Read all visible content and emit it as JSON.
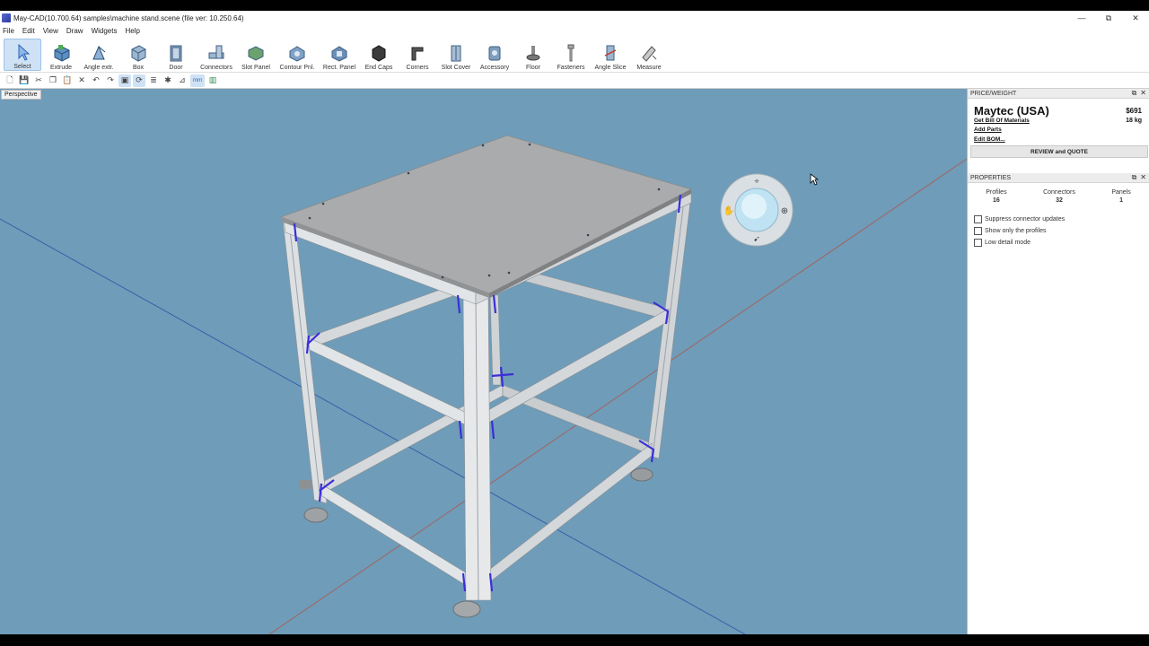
{
  "window": {
    "title": "May-CAD(10.700.64) samples\\machine stand.scene (file ver: 10.250.64)",
    "controls": {
      "minimize": "—",
      "restore": "⧉",
      "close": "✕"
    }
  },
  "menu": [
    "File",
    "Edit",
    "View",
    "Draw",
    "Widgets",
    "Help"
  ],
  "ribbon": {
    "tools": [
      {
        "label": "Select",
        "icon": "cursor-icon",
        "active": true
      },
      {
        "label": "Extrude",
        "icon": "extrude-icon"
      },
      {
        "label": "Angle extr.",
        "icon": "angle-extrude-icon"
      },
      {
        "label": "Box",
        "icon": "box-icon"
      },
      {
        "label": "Door",
        "icon": "door-icon"
      },
      {
        "label": "Connectors",
        "icon": "connectors-icon"
      },
      {
        "label": "Slot Panel",
        "icon": "slot-panel-icon"
      },
      {
        "label": "Contour Pnl.",
        "icon": "contour-panel-icon"
      },
      {
        "label": "Rect. Panel",
        "icon": "rect-panel-icon"
      },
      {
        "label": "End Caps",
        "icon": "end-caps-icon"
      },
      {
        "label": "Corners",
        "icon": "corners-icon"
      },
      {
        "label": "Slot Cover",
        "icon": "slot-cover-icon"
      },
      {
        "label": "Accessory",
        "icon": "accessory-icon"
      },
      {
        "label": "Floor",
        "icon": "floor-icon"
      },
      {
        "label": "Fasteners",
        "icon": "fasteners-icon"
      },
      {
        "label": "Angle Slice",
        "icon": "angle-slice-icon"
      },
      {
        "label": "Measure",
        "icon": "measure-icon"
      }
    ]
  },
  "quickbar": {
    "buttons": [
      {
        "name": "new-icon",
        "glyph": "🗋"
      },
      {
        "name": "save-icon",
        "glyph": "💾"
      },
      {
        "name": "cut-icon",
        "glyph": "✂"
      },
      {
        "name": "copy-icon",
        "glyph": "❐"
      },
      {
        "name": "paste-icon",
        "glyph": "📋"
      },
      {
        "name": "delete-icon",
        "glyph": "✕"
      },
      {
        "name": "undo-icon",
        "glyph": "↶"
      },
      {
        "name": "redo-icon",
        "glyph": "↷"
      },
      {
        "name": "frame-icon",
        "glyph": "▣"
      },
      {
        "name": "rotate-icon",
        "glyph": "⟳"
      },
      {
        "name": "layers-icon",
        "glyph": "≣"
      },
      {
        "name": "settings-icon",
        "glyph": "✱"
      },
      {
        "name": "dimension-icon",
        "glyph": "⊿"
      },
      {
        "name": "units-icon",
        "glyph": "mm"
      },
      {
        "name": "profile-icon",
        "glyph": "▥"
      }
    ]
  },
  "viewport": {
    "view_mode": "Perspective",
    "background": "#6f9cb8"
  },
  "price_weight": {
    "header": "PRICE/WEIGHT",
    "vendor": "Maytec (USA)",
    "price": "$691",
    "weight": "18 kg",
    "links": [
      "Get Bill Of Materials",
      "Add Parts",
      "Edit BOM..."
    ],
    "quote_button": "REVIEW and QUOTE"
  },
  "properties": {
    "header": "PROPERTIES",
    "stats": [
      {
        "label": "Profiles",
        "value": "16"
      },
      {
        "label": "Connectors",
        "value": "32"
      },
      {
        "label": "Panels",
        "value": "1"
      }
    ],
    "checkboxes": [
      {
        "label": "Suppress connector updates",
        "checked": false
      },
      {
        "label": "Show only the profiles",
        "checked": false
      },
      {
        "label": "Low detail mode",
        "checked": false
      }
    ]
  },
  "panel_icons": {
    "pin": "⧉",
    "close": "✕"
  },
  "colors": {
    "accent": "#2b64b5",
    "connector": "#3a2fd8",
    "profile": "#d4d7da",
    "tabletop": "#a9abad"
  }
}
